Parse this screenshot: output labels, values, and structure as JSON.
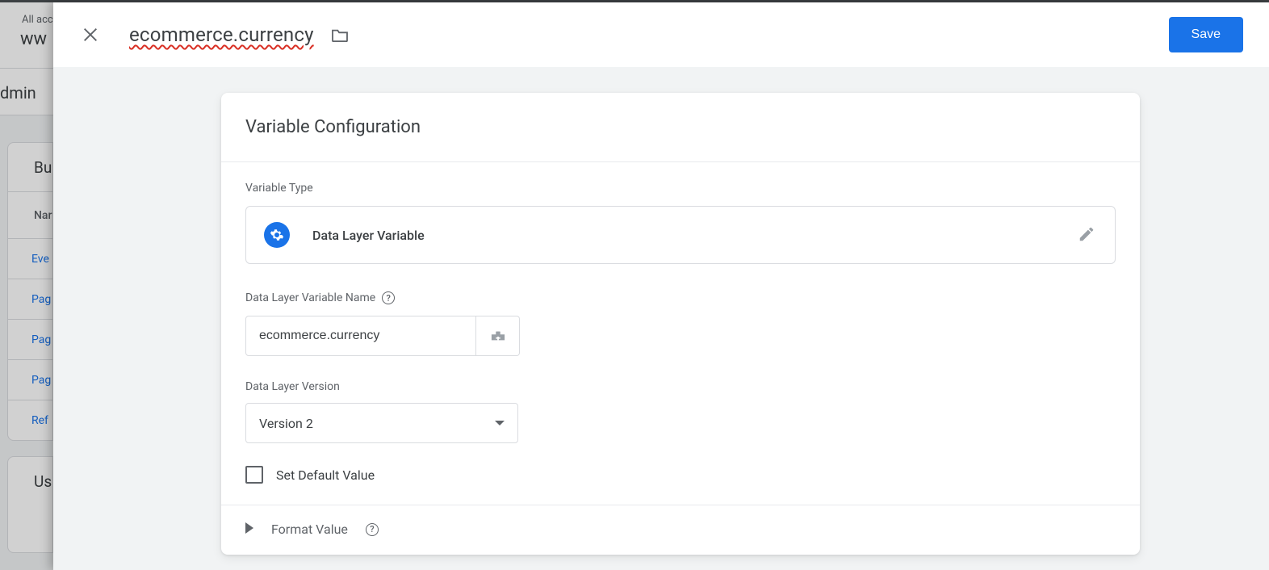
{
  "background": {
    "line1": "All acc",
    "line2": "ww",
    "subheader": "dmin",
    "table1": {
      "heading": "Bu",
      "subheading": "Nar",
      "rows": [
        "Eve",
        "Pag",
        "Pag",
        "Pag",
        "Ref"
      ]
    },
    "table2": {
      "heading": "Us"
    }
  },
  "drawer": {
    "title": "ecommerce.currency",
    "save_label": "Save"
  },
  "config": {
    "card_title": "Variable Configuration",
    "type_label": "Variable Type",
    "type_name": "Data Layer Variable",
    "name_label": "Data Layer Variable Name",
    "name_value": "ecommerce.currency",
    "version_label": "Data Layer Version",
    "version_value": "Version 2",
    "default_label": "Set Default Value",
    "format_label": "Format Value"
  }
}
